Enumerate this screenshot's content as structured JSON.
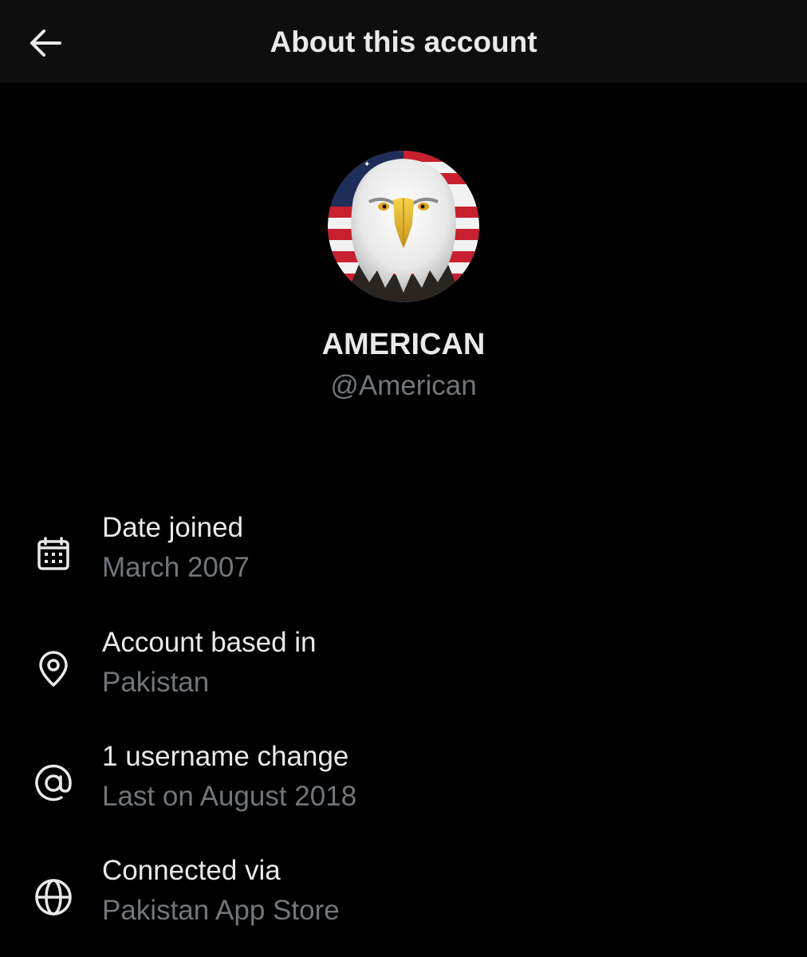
{
  "header": {
    "back_icon": "arrow-left-icon",
    "title": "About this account"
  },
  "profile": {
    "avatar": "bald-eagle-with-american-flag",
    "display_name": "AMERICAN",
    "handle": "@American"
  },
  "details": [
    {
      "icon": "calendar-icon",
      "label": "Date joined",
      "value": "March 2007"
    },
    {
      "icon": "location-pin-icon",
      "label": "Account based in",
      "value": "Pakistan"
    },
    {
      "icon": "at-sign-icon",
      "label": "1 username change",
      "value": "Last on August 2018"
    },
    {
      "icon": "globe-icon",
      "label": "Connected via",
      "value": "Pakistan App Store"
    }
  ],
  "colors": {
    "background": "#000000",
    "header_background": "#0e0e0e",
    "primary_text": "#e7e9ea",
    "secondary_text": "#71767b"
  }
}
